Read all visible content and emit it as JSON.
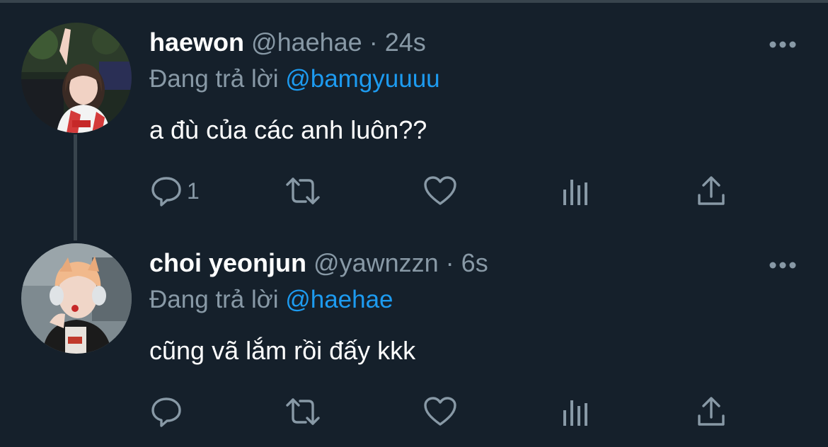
{
  "tweets": [
    {
      "name": "haewon",
      "handle": "@haehae",
      "separator": "·",
      "time": "24s",
      "reply_prefix": "Đang trả lời",
      "reply_to": "@bamgyuuuu",
      "text": "a đù của các anh luôn??",
      "reply_count": "1"
    },
    {
      "name": "choi yeonjun",
      "handle": "@yawnzzn",
      "separator": "·",
      "time": "6s",
      "reply_prefix": "Đang trả lời",
      "reply_to": "@haehae",
      "text": "cũng vã lắm rồi đấy kkk",
      "reply_count": ""
    }
  ],
  "icons": {
    "reply": "reply-icon",
    "retweet": "retweet-icon",
    "like": "heart-icon",
    "analytics": "analytics-icon",
    "share": "share-icon",
    "more": "more-icon"
  },
  "colors": {
    "background": "#15202b",
    "text_primary": "#ffffff",
    "text_secondary": "#8899a6",
    "mention": "#1d9bf0",
    "divider": "#38444d"
  }
}
